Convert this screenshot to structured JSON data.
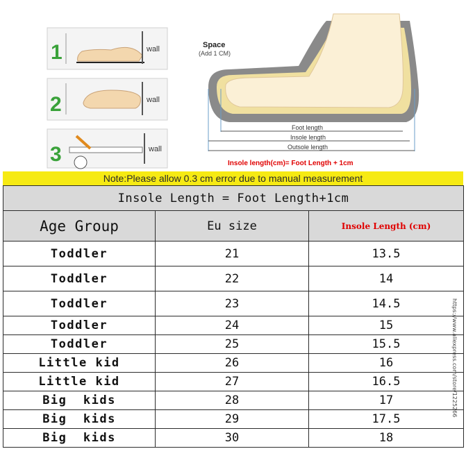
{
  "illustration": {
    "steps": [
      {
        "number": "1",
        "label": "wall"
      },
      {
        "number": "2",
        "label": "wall"
      },
      {
        "number": "3",
        "label": "wall"
      }
    ],
    "space_label": "Space",
    "space_sub": "(Add 1 CM)",
    "foot_length": "Foot length",
    "insole_length": "Insole length",
    "outsole_length": "Outsole length",
    "formula": "Insole length(cm)= Foot Length + 1cm",
    "colors": {
      "step_number": "#3aa23a",
      "formula": "#e00000",
      "sole": "#777777",
      "insole": "#f0e0a0"
    }
  },
  "note": "Note:Please allow 0.3 cm error due to manual measurement",
  "table": {
    "title": "Insole Length = Foot Length+1cm",
    "headers": {
      "age": "Age Group",
      "eu": "Eu size",
      "insole": "Insole Length (cm)"
    },
    "rows": [
      {
        "age": "Toddler",
        "eu": "21",
        "insole": "13.5"
      },
      {
        "age": "Toddler",
        "eu": "22",
        "insole": "14"
      },
      {
        "age": "Toddler",
        "eu": "23",
        "insole": "14.5"
      },
      {
        "age": "Toddler",
        "eu": "24",
        "insole": "15"
      },
      {
        "age": "Toddler",
        "eu": "25",
        "insole": "15.5"
      },
      {
        "age": "Little kid",
        "eu": "26",
        "insole": "16"
      },
      {
        "age": "Little kid",
        "eu": "27",
        "insole": "16.5"
      },
      {
        "age": "Big  kids",
        "eu": "28",
        "insole": "17"
      },
      {
        "age": "Big  kids",
        "eu": "29",
        "insole": "17.5"
      },
      {
        "age": "Big  kids",
        "eu": "30",
        "insole": "18"
      }
    ]
  },
  "watermark": "https://www.aliexpress.com/store/1225266"
}
